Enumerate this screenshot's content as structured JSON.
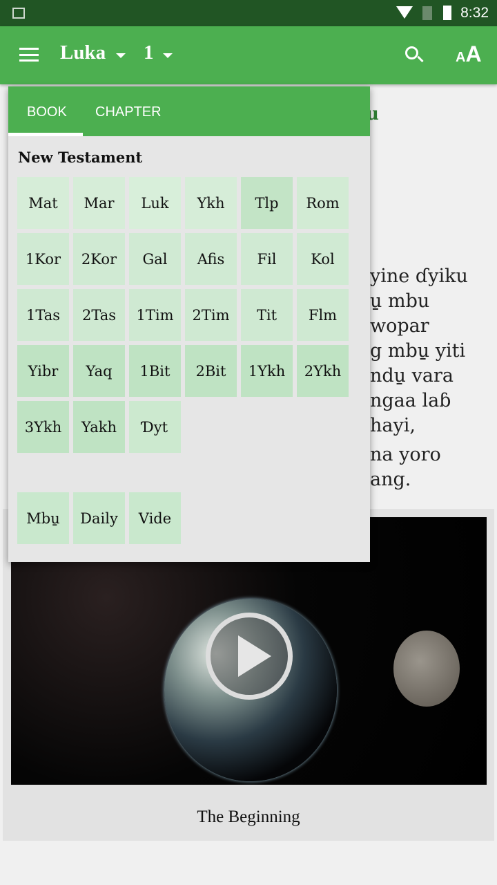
{
  "status_bar": {
    "time": "8:32"
  },
  "toolbar": {
    "book": "Luka",
    "chapter": "1"
  },
  "reader": {
    "heading_fragment": "u",
    "lines": [
      "yine ɗyiku",
      "u̱ mbu",
      "wopar",
      "g mbu̱ yiti",
      "ndu̱ vara",
      "ngaa laɓ",
      "hayi,",
      "na yoro",
      "ang."
    ]
  },
  "popup": {
    "tabs": [
      "BOOK",
      "CHAPTER"
    ],
    "active_tab": "BOOK",
    "section": "New Testament",
    "books": [
      "Mat",
      "Mar",
      "Luk",
      "Ykh",
      "Tlp",
      "Rom",
      "1Kor",
      "2Kor",
      "Gal",
      "Afis",
      "Fil",
      "Kol",
      "1Tas",
      "2Tas",
      "1Tim",
      "2Tim",
      "Tit",
      "Flm",
      "Yibr",
      "Yaq",
      "1Bit",
      "2Bit",
      "1Ykh",
      "2Ykh",
      "3Ykh",
      "Yakh",
      "Ɗyt"
    ],
    "extras": [
      "Mbu̱",
      "Daily",
      "Vide"
    ]
  },
  "video": {
    "caption": "The Beginning"
  },
  "colors": {
    "status": "#215524",
    "toolbar": "#4caf50"
  }
}
